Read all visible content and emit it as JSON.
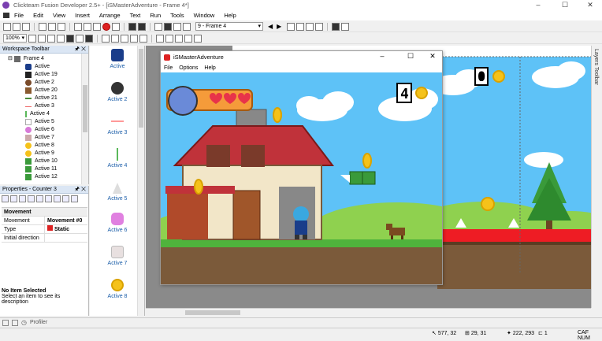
{
  "window": {
    "title": "Clickteam Fusion Developer 2.5+ - [iSMasterAdventure - Frame 4*]"
  },
  "menu": [
    "File",
    "Edit",
    "View",
    "Insert",
    "Arrange",
    "Text",
    "Run",
    "Tools",
    "Window",
    "Help"
  ],
  "toolbar": {
    "frame_combo": "9 - Frame 4",
    "zoom": "100%"
  },
  "workspace": {
    "title": "Workspace Toolbar",
    "root": "Frame 4",
    "items": [
      "Active",
      "Active 19",
      "Active 2",
      "Active 20",
      "Active 21",
      "Active 3",
      "Active 4",
      "Active 5",
      "Active 6",
      "Active 7",
      "Active 8",
      "Active 9",
      "Active 10",
      "Active 11",
      "Active 12"
    ]
  },
  "properties": {
    "title": "Properties - Counter 3",
    "section": "Movement",
    "rows": [
      {
        "key": "Movement",
        "value": "Movement #0"
      },
      {
        "key": "Type",
        "value": "Static"
      },
      {
        "key": "Initial direction",
        "value": ""
      }
    ],
    "no_item_title": "No Item Selected",
    "no_item_text": "Select an item to see its description"
  },
  "objects": [
    "Active",
    "Active 2",
    "Active 3",
    "Active 4",
    "Active 5",
    "Active 6",
    "Active 7",
    "Active 8"
  ],
  "game": {
    "title": "iSMasterAdventure",
    "menu": [
      "File",
      "Options",
      "Help"
    ],
    "score_left": "4",
    "score_right": "0"
  },
  "layers_label": "Layers Toolbar",
  "bottom": {
    "profiler": "Profiler"
  },
  "status": {
    "coords1": "577, 32",
    "coords2": "29, 31",
    "coords3": "222, 293",
    "count": "1",
    "keys": "CAF NUM"
  },
  "colors": {
    "sky": "#5ec2f7",
    "ground": "#7b5a3a",
    "grass": "#4fb33c",
    "red_bar": "#ee1c24",
    "accent": "#1a5da8"
  }
}
